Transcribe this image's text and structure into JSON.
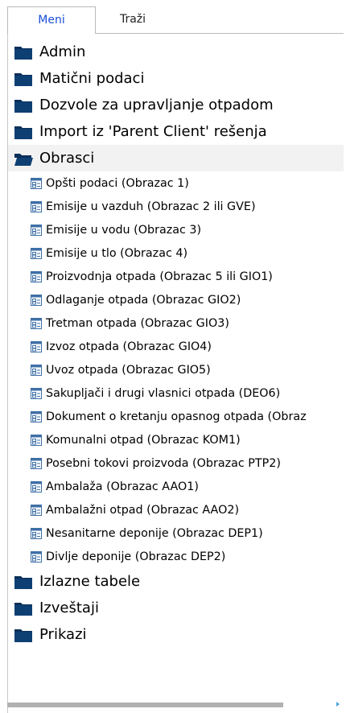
{
  "tabs": [
    {
      "label": "Meni",
      "active": true
    },
    {
      "label": "Traži",
      "active": false
    }
  ],
  "tree": {
    "before": [
      {
        "label": "Admin",
        "icon": "folder-icon"
      },
      {
        "label": "Matični podaci",
        "icon": "folder-icon"
      },
      {
        "label": "Dozvole za upravljanje otpadom",
        "icon": "folder-icon"
      },
      {
        "label": "Import iz 'Parent Client' rešenja",
        "icon": "folder-icon"
      }
    ],
    "expanded": {
      "label": "Obrasci",
      "icon": "folder-open-icon"
    },
    "children": [
      {
        "label": "Opšti podaci (Obrazac 1)",
        "icon": "form-icon"
      },
      {
        "label": "Emisije u vazduh (Obrazac 2 ili GVE)",
        "icon": "form-icon"
      },
      {
        "label": "Emisije u vodu (Obrazac 3)",
        "icon": "form-icon"
      },
      {
        "label": "Emisije u tlo (Obrazac 4)",
        "icon": "form-icon"
      },
      {
        "label": "Proizvodnja otpada (Obrazac 5 ili GIO1)",
        "icon": "form-icon"
      },
      {
        "label": "Odlaganje otpada (Obrazac GIO2)",
        "icon": "form-icon"
      },
      {
        "label": "Tretman otpada (Obrazac GIO3)",
        "icon": "form-icon"
      },
      {
        "label": "Izvoz otpada (Obrazac GIO4)",
        "icon": "form-icon"
      },
      {
        "label": "Uvoz otpada (Obrazac GIO5)",
        "icon": "form-icon"
      },
      {
        "label": "Sakupljači i drugi vlasnici otpada (DEO6)",
        "icon": "form-icon"
      },
      {
        "label": "Dokument o kretanju opasnog otpada (Obraz",
        "icon": "form-icon"
      },
      {
        "label": "Komunalni otpad (Obrazac KOM1)",
        "icon": "form-icon"
      },
      {
        "label": "Posebni tokovi proizvoda (Obrazac PTP2)",
        "icon": "form-icon"
      },
      {
        "label": "Ambalaža (Obrazac AAO1)",
        "icon": "form-icon"
      },
      {
        "label": "Ambalažni otpad (Obrazac AAO2)",
        "icon": "form-icon"
      },
      {
        "label": "Nesanitarne deponije (Obrazac DEP1)",
        "icon": "form-icon"
      },
      {
        "label": "Divlje deponije (Obrazac DEP2)",
        "icon": "form-icon"
      }
    ],
    "after": [
      {
        "label": "Izlazne tabele",
        "icon": "folder-icon"
      },
      {
        "label": "Izveštaji",
        "icon": "folder-icon"
      },
      {
        "label": "Prikazi",
        "icon": "folder-icon"
      }
    ]
  },
  "colors": {
    "folder": "#0e3f73",
    "folder_shade": "#0a2f58",
    "form_icon": "#3e6fa6",
    "active_tab_text": "#1a4fd8",
    "scrollbar": "#b1b1b1",
    "scroll_arrow": "#4aa3d8"
  }
}
